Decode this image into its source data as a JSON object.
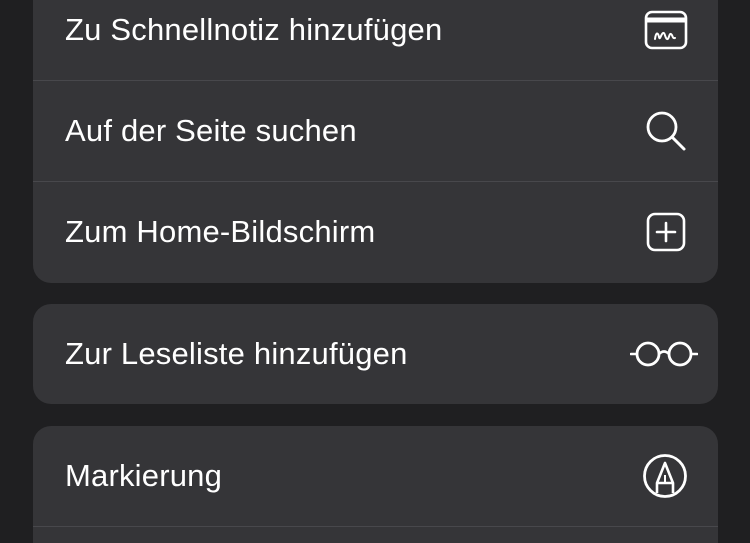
{
  "menu": {
    "group1": [
      {
        "label": "Zu Schnellnotiz hinzufügen",
        "icon": "quick-note-icon"
      },
      {
        "label": "Auf der Seite suchen",
        "icon": "search-icon"
      },
      {
        "label": "Zum Home-Bildschirm",
        "icon": "add-square-icon"
      }
    ],
    "group2": [
      {
        "label": "Zur Leseliste hinzufügen",
        "icon": "glasses-icon"
      }
    ],
    "group3": [
      {
        "label": "Markierung",
        "icon": "markup-pen-icon"
      }
    ]
  },
  "colors": {
    "background": "#1f1f21",
    "group_background": "#353538",
    "divider": "#48484c",
    "text": "#ffffff"
  }
}
